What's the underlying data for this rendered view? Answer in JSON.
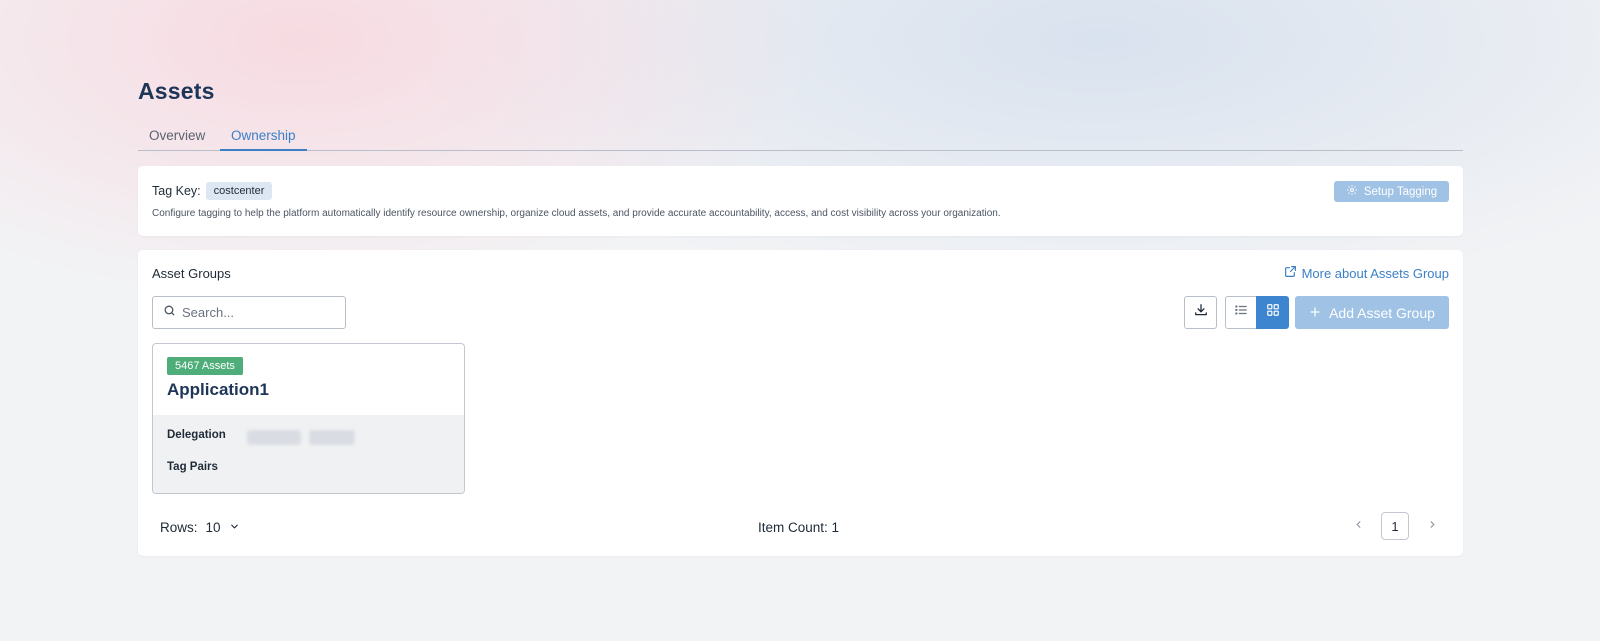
{
  "page": {
    "title": "Assets"
  },
  "tabs": [
    {
      "label": "Overview",
      "active": false
    },
    {
      "label": "Ownership",
      "active": true
    }
  ],
  "tagging": {
    "label": "Tag Key:",
    "value": "costcenter",
    "description": "Configure tagging to help the platform automatically identify resource ownership, organize cloud assets, and provide accurate accountability, access, and cost visibility across your organization.",
    "setup_button": "Setup Tagging"
  },
  "asset_groups": {
    "title": "Asset Groups",
    "more_link": "More about Assets Group",
    "search": {
      "placeholder": "Search...",
      "value": ""
    },
    "add_button": "Add Asset Group",
    "view_mode": "grid",
    "cards": [
      {
        "badge": "5467 Assets",
        "name": "Application1",
        "delegation_label": "Delegation",
        "tag_pairs_label": "Tag Pairs"
      }
    ]
  },
  "pagination": {
    "rows_label": "Rows:",
    "rows_value": "10",
    "item_count": "Item Count: 1",
    "current_page": "1"
  },
  "colors": {
    "accent": "#3d86cf",
    "accent_light": "#9fc2e5",
    "badge_green": "#4fad7a",
    "title_navy": "#1e3558"
  }
}
